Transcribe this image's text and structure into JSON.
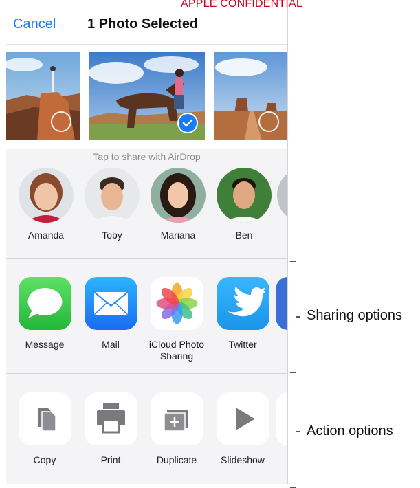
{
  "watermark": "APPLE CONFIDENTIAL",
  "nav": {
    "cancel_label": "Cancel",
    "title": "1 Photo Selected"
  },
  "photos": [
    {
      "name": "canyon-cliff",
      "selected": false
    },
    {
      "name": "horse-rider",
      "selected": true
    },
    {
      "name": "desert-road",
      "selected": false
    }
  ],
  "airdrop": {
    "hint": "Tap to share with AirDrop",
    "people": [
      "Amanda",
      "Toby",
      "Mariana",
      "Ben"
    ]
  },
  "sharing": {
    "apps": [
      {
        "label": "Message",
        "icon": "message-icon",
        "color": "#34c759"
      },
      {
        "label": "Mail",
        "icon": "mail-icon",
        "color": "#1a8cff"
      },
      {
        "label_line1": "iCloud Photo",
        "label_line2": "Sharing",
        "icon": "photos-icon"
      },
      {
        "label": "Twitter",
        "icon": "twitter-icon",
        "color": "#1da1f2"
      }
    ]
  },
  "actions": {
    "items": [
      {
        "label": "Copy",
        "icon": "copy-icon"
      },
      {
        "label": "Print",
        "icon": "print-icon"
      },
      {
        "label": "Duplicate",
        "icon": "duplicate-icon"
      },
      {
        "label": "Slideshow",
        "icon": "slideshow-icon"
      }
    ]
  },
  "annotations": {
    "sharing": "Sharing options",
    "action": "Action options"
  }
}
